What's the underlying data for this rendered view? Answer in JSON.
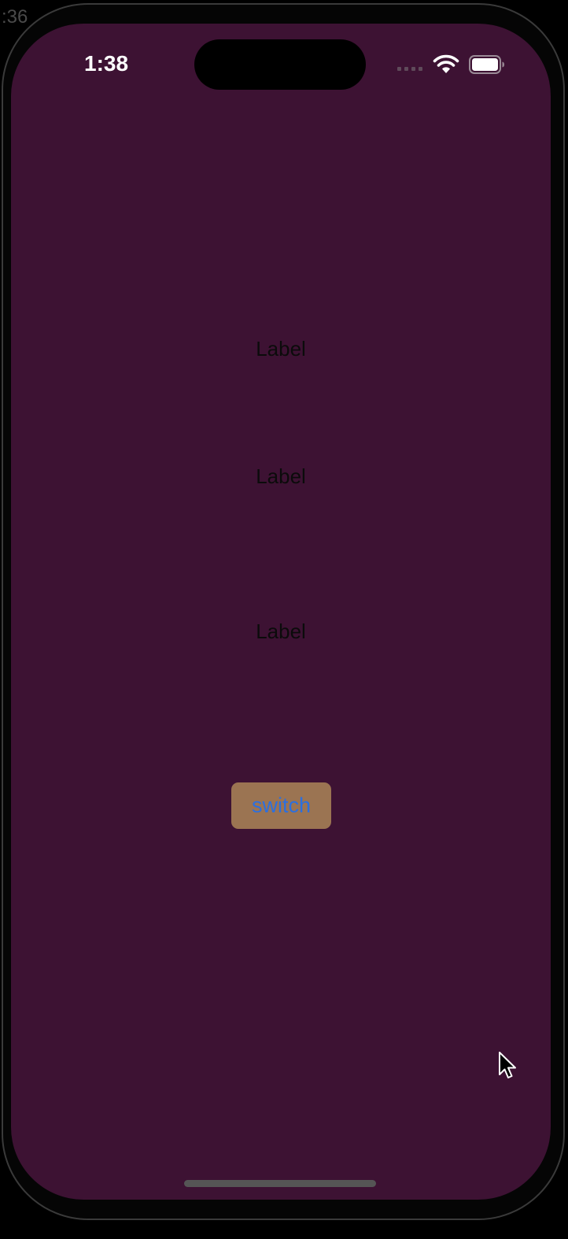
{
  "background_clock": ":36",
  "status_bar": {
    "time": "1:38",
    "icons": [
      "signal-icon",
      "wifi-icon",
      "battery-icon"
    ]
  },
  "labels": [
    "Label",
    "Label",
    "Label"
  ],
  "switch_button": {
    "label": "switch"
  },
  "colors": {
    "screen_background": "#3d1233",
    "label_text": "#0b0b0b",
    "button_background": "#9b7452",
    "button_text": "#2b6fe0"
  }
}
